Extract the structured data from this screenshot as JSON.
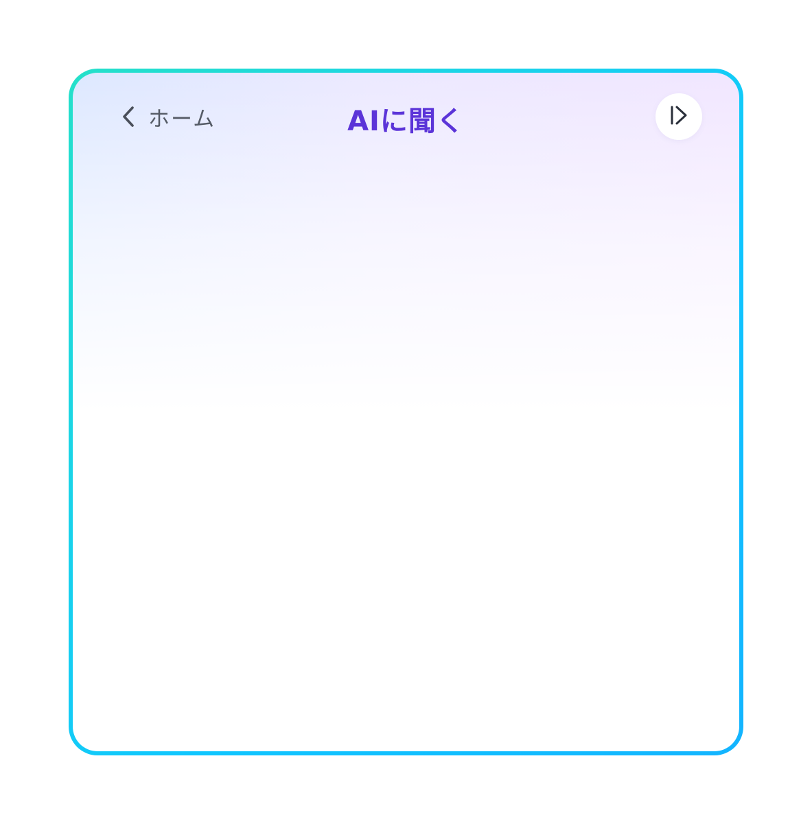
{
  "header": {
    "back_label": "ホーム",
    "back_icon": "chevron-left-icon",
    "title": "AIに聞く",
    "collapse_icon": "panel-collapse-icon"
  },
  "colors": {
    "title": "#5b34d8",
    "back_text": "#555b66",
    "border_start": "#25e0c9",
    "border_end": "#13b4ff"
  }
}
